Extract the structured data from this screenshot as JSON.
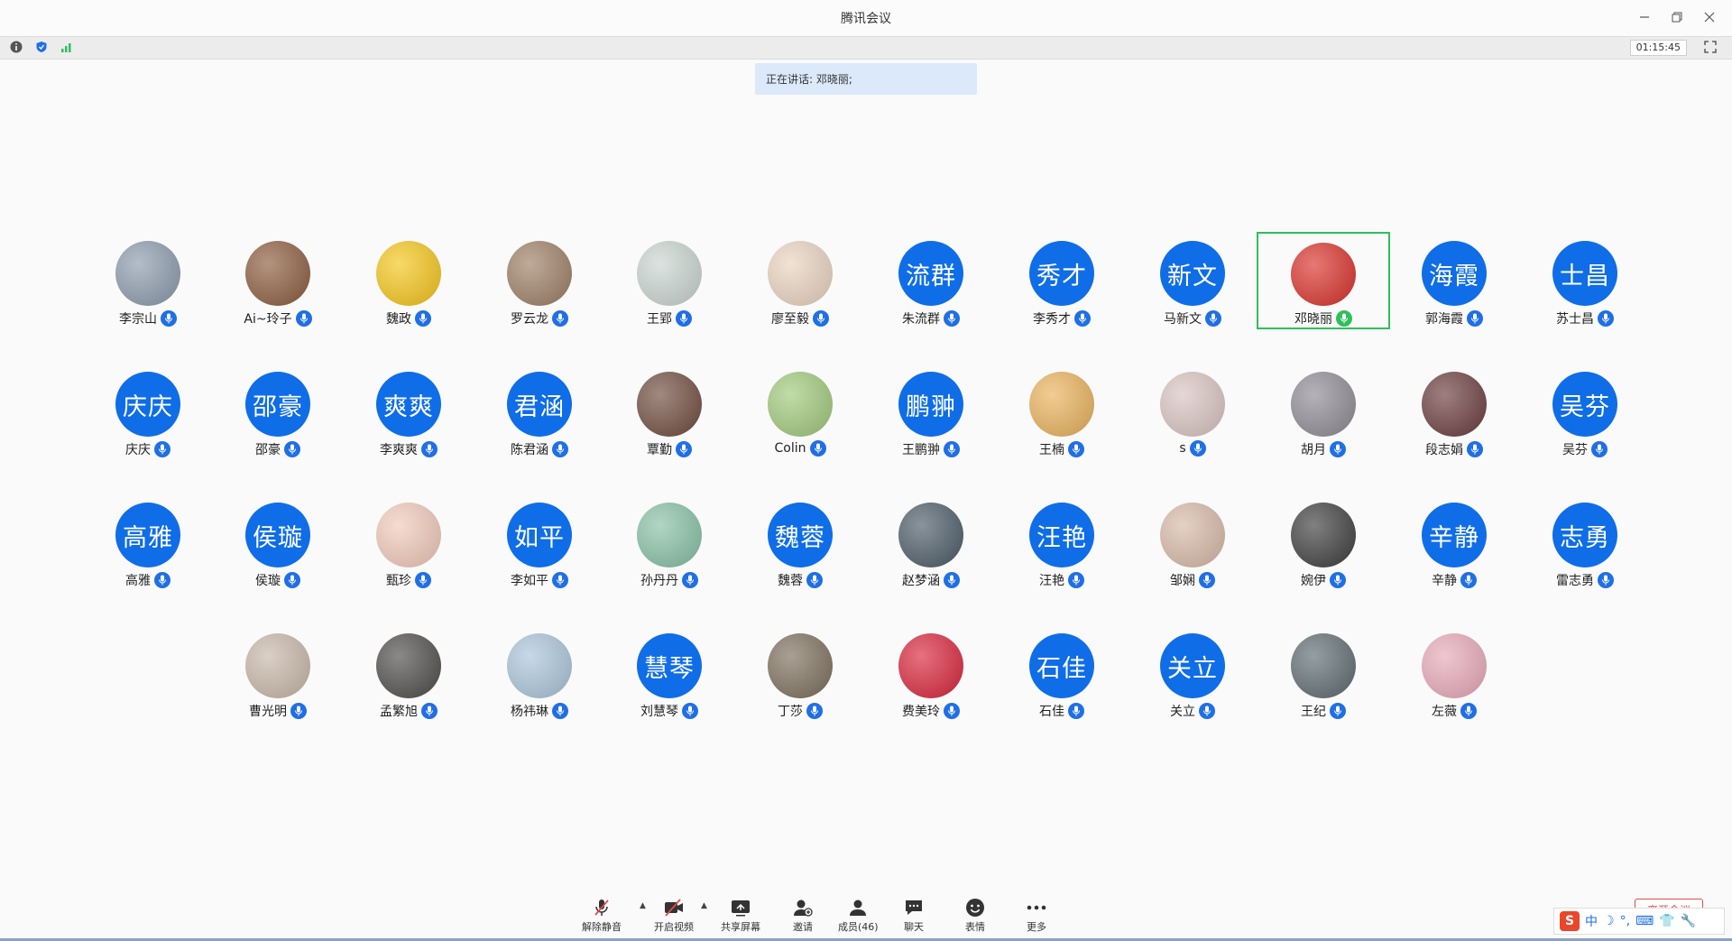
{
  "window": {
    "title": "腾讯会议"
  },
  "infobar": {
    "timer": "01:15:45"
  },
  "speaking": {
    "label": "正在讲话: 邓晓丽;"
  },
  "participants": [
    {
      "name": "李宗山",
      "type": "photo",
      "color": "#8a9aab"
    },
    {
      "name": "Ai~玲子",
      "type": "photo",
      "color": "#8b5a3c"
    },
    {
      "name": "魏政",
      "type": "photo",
      "color": "#f5c518"
    },
    {
      "name": "罗云龙",
      "type": "photo",
      "color": "#9c7d63"
    },
    {
      "name": "王郢",
      "type": "photo",
      "color": "#c9d4cf"
    },
    {
      "name": "廖至毅",
      "type": "photo",
      "color": "#e9d3bf"
    },
    {
      "name": "朱流群",
      "type": "text",
      "initials": "流群"
    },
    {
      "name": "李秀才",
      "type": "text",
      "initials": "秀才"
    },
    {
      "name": "马新文",
      "type": "text",
      "initials": "新文"
    },
    {
      "name": "邓晓丽",
      "type": "photo",
      "color": "#d9302a",
      "active": true
    },
    {
      "name": "郭海霞",
      "type": "text",
      "initials": "海霞"
    },
    {
      "name": "苏士昌",
      "type": "text",
      "initials": "士昌"
    },
    {
      "name": "庆庆",
      "type": "text",
      "initials": "庆庆"
    },
    {
      "name": "邵豪",
      "type": "text",
      "initials": "邵豪"
    },
    {
      "name": "李爽爽",
      "type": "text",
      "initials": "爽爽"
    },
    {
      "name": "陈君涵",
      "type": "text",
      "initials": "君涵"
    },
    {
      "name": "覃勤",
      "type": "photo",
      "color": "#6e4a3c"
    },
    {
      "name": "Colin",
      "type": "photo",
      "color": "#9fc97a"
    },
    {
      "name": "王鹏翀",
      "type": "text",
      "initials": "鹏翀"
    },
    {
      "name": "王楠",
      "type": "photo",
      "color": "#e9b15a"
    },
    {
      "name": "s",
      "type": "photo",
      "color": "#d8c3c0"
    },
    {
      "name": "胡月",
      "type": "photo",
      "color": "#8d8a92"
    },
    {
      "name": "段志娟",
      "type": "photo",
      "color": "#6a3b3d"
    },
    {
      "name": "吴芬",
      "type": "text",
      "initials": "吴芬"
    },
    {
      "name": "高雅",
      "type": "text",
      "initials": "高雅"
    },
    {
      "name": "侯璇",
      "type": "text",
      "initials": "侯璇"
    },
    {
      "name": "甄珍",
      "type": "photo",
      "color": "#f0c9b8"
    },
    {
      "name": "李如平",
      "type": "text",
      "initials": "如平"
    },
    {
      "name": "孙丹丹",
      "type": "photo",
      "color": "#86c0a4"
    },
    {
      "name": "魏蓉",
      "type": "text",
      "initials": "魏蓉"
    },
    {
      "name": "赵梦涵",
      "type": "photo",
      "color": "#4a5a66"
    },
    {
      "name": "汪艳",
      "type": "text",
      "initials": "汪艳"
    },
    {
      "name": "邹娴",
      "type": "photo",
      "color": "#d7b8a6"
    },
    {
      "name": "婉伊",
      "type": "photo",
      "color": "#3c3c3c"
    },
    {
      "name": "辛静",
      "type": "text",
      "initials": "辛静"
    },
    {
      "name": "雷志勇",
      "type": "text",
      "initials": "志勇"
    },
    {
      "name": "曹光明",
      "type": "photo",
      "color": "#c7b6a8"
    },
    {
      "name": "孟繁旭",
      "type": "photo",
      "color": "#4d4a48"
    },
    {
      "name": "杨祎琳",
      "type": "photo",
      "color": "#a9c4d9"
    },
    {
      "name": "刘慧琴",
      "type": "text",
      "initials": "慧琴"
    },
    {
      "name": "丁莎",
      "type": "photo",
      "color": "#7b6d5a"
    },
    {
      "name": "费美玲",
      "type": "photo",
      "color": "#d8243a"
    },
    {
      "name": "石佳",
      "type": "text",
      "initials": "石佳"
    },
    {
      "name": "关立",
      "type": "text",
      "initials": "关立"
    },
    {
      "name": "王纪",
      "type": "photo",
      "color": "#5d6a6f"
    },
    {
      "name": "左薇",
      "type": "photo",
      "color": "#e7a8b8"
    }
  ],
  "toolbar": {
    "unmute": "解除静音",
    "video": "开启视频",
    "share": "共享屏幕",
    "invite": "邀请",
    "members": "成员(46)",
    "chat": "聊天",
    "emoji": "表情",
    "more": "更多"
  },
  "leave": {
    "label": "离开会议"
  },
  "ime": {
    "lang": "中"
  }
}
